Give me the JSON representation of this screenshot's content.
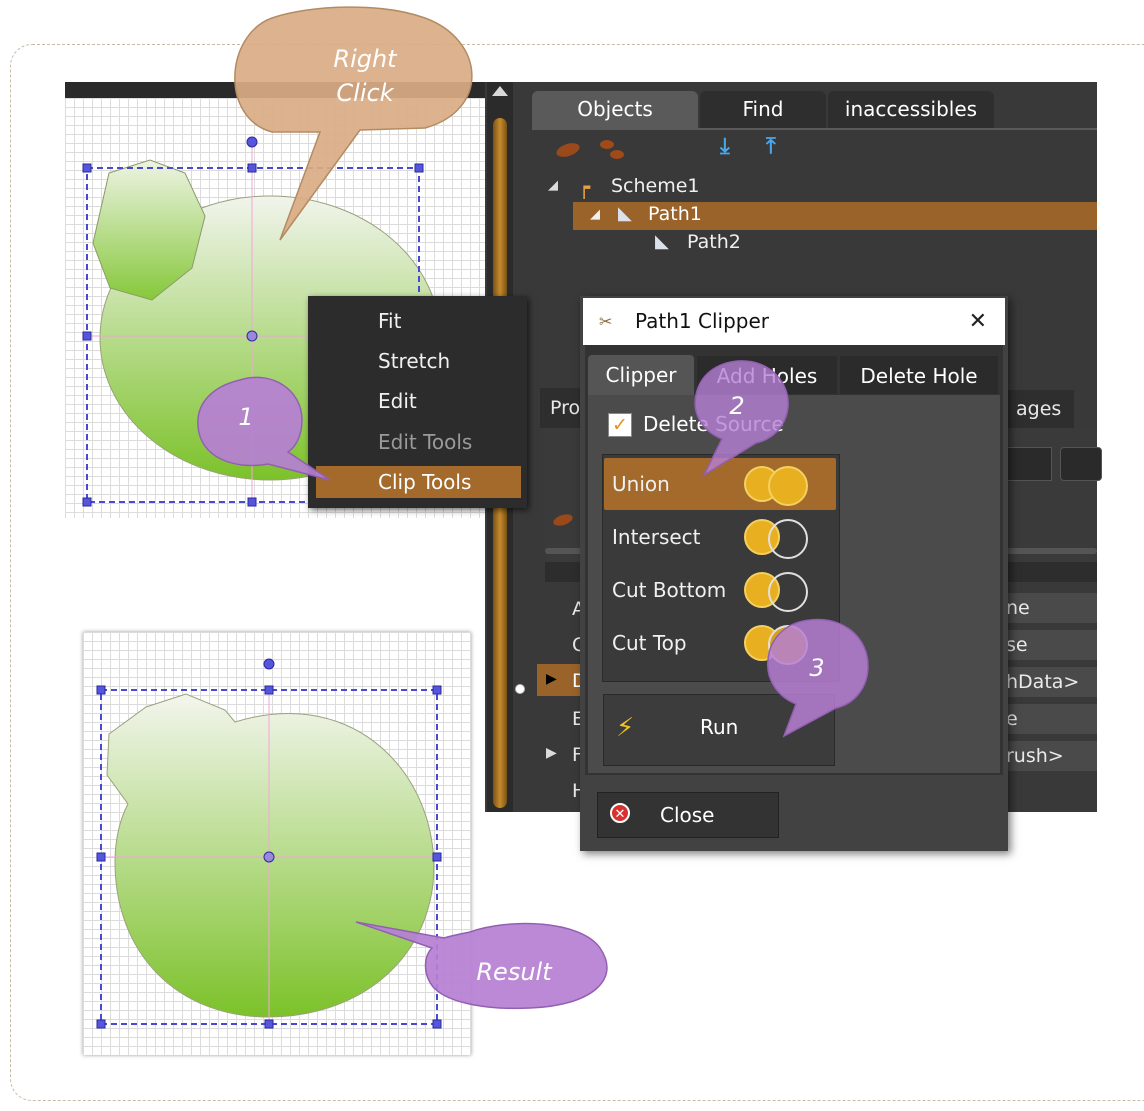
{
  "callouts": {
    "right_click": "Right Click",
    "step1": "1",
    "step2": "2",
    "step3": "3",
    "result": "Result"
  },
  "objects_panel": {
    "tabs": [
      "Objects",
      "Find",
      "inaccessibles"
    ],
    "tree": [
      "Scheme1",
      "Path1",
      "Path2"
    ]
  },
  "context_menu": {
    "items": [
      "Fit",
      "Stretch",
      "Edit",
      "Edit Tools",
      "Clip Tools"
    ]
  },
  "clipper_dialog": {
    "title": "Path1  Clipper",
    "close_glyph": "✕",
    "tabs": [
      "Clipper",
      "Add Holes",
      "Delete Hole"
    ],
    "delete_source_label": "Delete Source",
    "delete_source_checked": true,
    "operations": [
      "Union",
      "Intersect",
      "Cut Bottom",
      "Cut Top"
    ],
    "selected_operation": "Union",
    "run_label": "Run",
    "close_label": "Close"
  },
  "background_panel": {
    "partial_tab_left": "Pro",
    "partial_tab_right": "ages",
    "row_prefixes": [
      "A",
      "C",
      "D",
      "E",
      "F",
      "H"
    ],
    "row_values": [
      "ne",
      "se",
      "hData>",
      "e",
      "rush>"
    ]
  },
  "colors": {
    "accent": "#a36a2c",
    "selection": "#9a632a",
    "callout_purple": "#b67fd4",
    "callout_tan": "#d9ad84",
    "shape_green": "#7cc22a",
    "handle_blue": "#4a4ad0"
  }
}
